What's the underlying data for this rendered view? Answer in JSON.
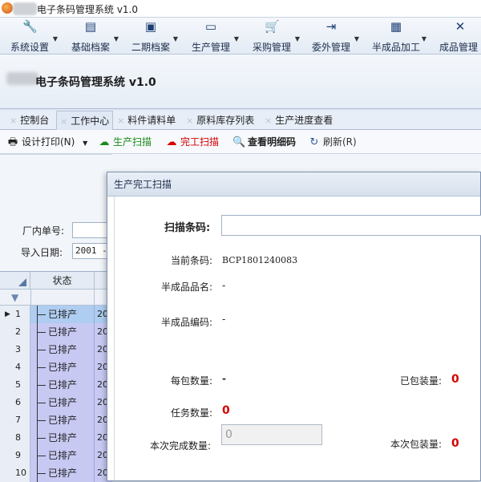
{
  "window": {
    "title": "电子条码管理系统 v1.0"
  },
  "menu": [
    {
      "label": "系统设置",
      "icon": "wrench-icon"
    },
    {
      "label": "基础档案",
      "icon": "book-icon"
    },
    {
      "label": "二期档案",
      "icon": "id-card-icon"
    },
    {
      "label": "生产管理",
      "icon": "monitor-icon"
    },
    {
      "label": "采购管理",
      "icon": "cart-icon"
    },
    {
      "label": "委外管理",
      "icon": "login-icon"
    },
    {
      "label": "半成品加工",
      "icon": "building-icon"
    },
    {
      "label": "成品管理",
      "icon": "expand-icon"
    }
  ],
  "header": {
    "system_title": "电子条码管理系统 v1.0"
  },
  "tabs": [
    {
      "label": "控制台"
    },
    {
      "label": "工作中心"
    },
    {
      "label": "料件请料单"
    },
    {
      "label": "原料库存列表"
    },
    {
      "label": "生产进度查看"
    }
  ],
  "toolbar": {
    "print_label": "设计打印(N)",
    "produce_scan_label": "生产扫描",
    "finish_scan_label": "完工扫描",
    "detail_code_label": "查看明细码",
    "refresh_label": "刷新(R)"
  },
  "filters": {
    "factory_no_label": "厂内单号:",
    "import_date_label": "导入日期:",
    "import_date_value": "2001 -"
  },
  "grid": {
    "status_header": "状态",
    "rows": [
      {
        "num": "1",
        "status": "已排产",
        "date": "20"
      },
      {
        "num": "2",
        "status": "已排产",
        "date": "20"
      },
      {
        "num": "3",
        "status": "已排产",
        "date": "20"
      },
      {
        "num": "4",
        "status": "已排产",
        "date": "20"
      },
      {
        "num": "5",
        "status": "已排产",
        "date": "20"
      },
      {
        "num": "6",
        "status": "已排产",
        "date": "20"
      },
      {
        "num": "7",
        "status": "已排产",
        "date": "20"
      },
      {
        "num": "8",
        "status": "已排产",
        "date": "20"
      },
      {
        "num": "9",
        "status": "已排产",
        "date": "20"
      },
      {
        "num": "10",
        "status": "已排产",
        "date": "20"
      }
    ]
  },
  "dialog": {
    "title": "生产完工扫描",
    "scan_label": "扫描条码:",
    "current_code_label": "当前条码:",
    "current_code_value": "BCP1801240083",
    "semi_name_label": "半成品品名:",
    "semi_name_value": "-",
    "semi_code_label": "半成品编码:",
    "semi_code_value": "-",
    "per_pack_label": "每包数量:",
    "per_pack_value": "-",
    "packed_label": "已包装量:",
    "packed_value": "0",
    "task_qty_label": "任务数量:",
    "task_qty_value": "0",
    "finish_qty_label": "本次完成数量:",
    "finish_qty_placeholder": "0",
    "pack_qty_label": "本次包装量:",
    "pack_qty_value": "0"
  },
  "colors": {
    "produce_scan": "#1a8a1a",
    "finish_scan": "#d40000",
    "row_status_bg": "#c8c9f3",
    "accent_red": "#d40000"
  }
}
